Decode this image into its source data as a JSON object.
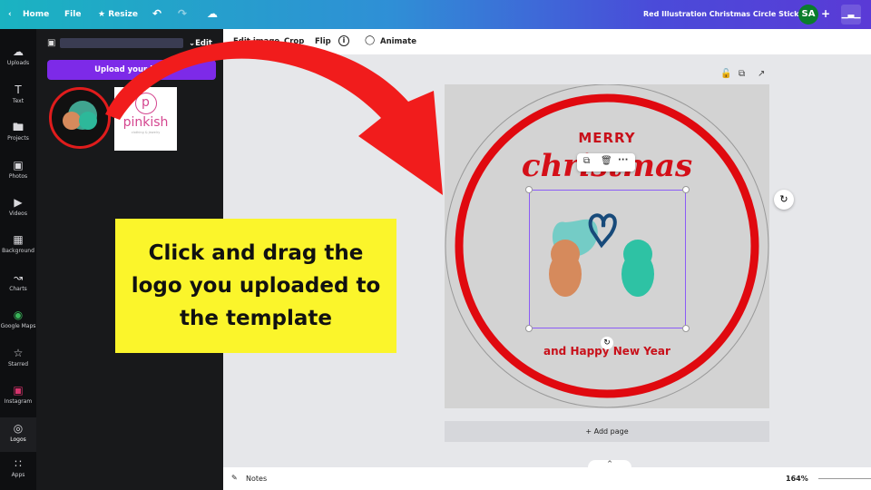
{
  "topbar": {
    "home": "Home",
    "file": "File",
    "resize": "Resize",
    "title": "Red Illustration Christmas Circle Sticker",
    "avatar": "SA",
    "colors": {
      "start": "#1ab3c1",
      "end": "#5a3ad6"
    }
  },
  "rail": [
    {
      "label": "Uploads",
      "icon": "cloud-upload-icon"
    },
    {
      "label": "Text",
      "icon": "text-icon"
    },
    {
      "label": "Projects",
      "icon": "folder-icon"
    },
    {
      "label": "Photos",
      "icon": "photo-icon"
    },
    {
      "label": "Videos",
      "icon": "video-icon"
    },
    {
      "label": "Background",
      "icon": "background-icon"
    },
    {
      "label": "Charts",
      "icon": "chart-icon"
    },
    {
      "label": "Google Maps",
      "icon": "google-maps-icon"
    },
    {
      "label": "Starred",
      "icon": "star-icon"
    },
    {
      "label": "Instagram",
      "icon": "instagram-icon"
    },
    {
      "label": "Logos",
      "icon": "logo-icon"
    },
    {
      "label": "Apps",
      "icon": "apps-icon"
    }
  ],
  "panel": {
    "edit": "Edit",
    "upload_button": "Upload your logo",
    "logo2_text": "pinkish",
    "logo2_sub": "clothing & jewelry"
  },
  "toolbar": {
    "edit_image": "Edit image",
    "crop": "Crop",
    "flip": "Flip",
    "animate": "Animate"
  },
  "design": {
    "merry": "MERRY",
    "christmas": "christmas",
    "new_year": "and Happy New Year"
  },
  "callout": "Click and drag the logo you uploaded to the template",
  "canvas": {
    "add_page": "+ Add page"
  },
  "bottom": {
    "notes": "Notes",
    "zoom": "164%"
  }
}
